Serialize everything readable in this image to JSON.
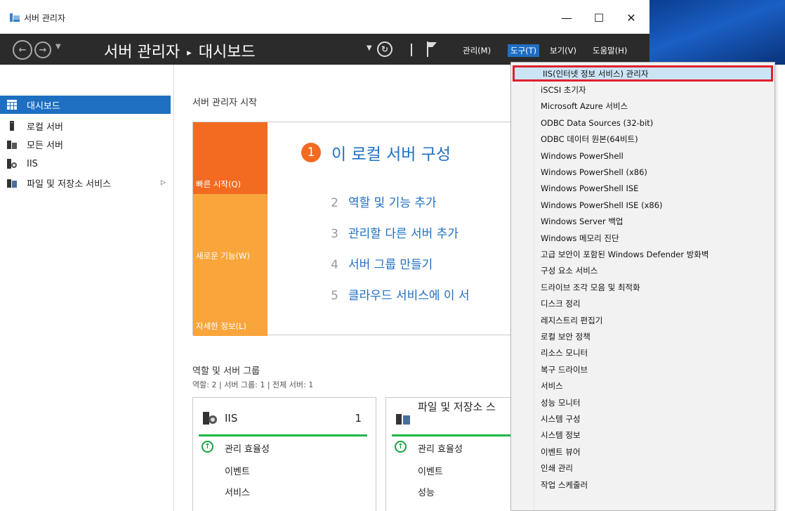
{
  "window": {
    "title": "서버 관리자",
    "minimize": "—",
    "maximize": "☐",
    "close": "✕"
  },
  "header": {
    "breadcrumb_root": "서버 관리자",
    "breadcrumb_sep": "▸",
    "breadcrumb_current": "대시보드",
    "menus": {
      "manage": "관리(M)",
      "tools": "도구(T)",
      "view": "보기(V)",
      "help": "도움말(H)"
    }
  },
  "sidebar": {
    "items": [
      {
        "label": "대시보드",
        "icon": "dashboard-icon"
      },
      {
        "label": "로컬 서버",
        "icon": "server-icon"
      },
      {
        "label": "모든 서버",
        "icon": "servers-icon"
      },
      {
        "label": "IIS",
        "icon": "iis-icon"
      },
      {
        "label": "파일 및 저장소 서비스",
        "icon": "file-storage-icon"
      }
    ]
  },
  "welcome": {
    "title": "서버 관리자 시작",
    "tiles": [
      "빠른 시작(Q)",
      "새로운 기능(W)",
      "자세한 정보(L)"
    ],
    "steps": [
      {
        "num": "1",
        "label": "이 로컬 서버 구성"
      },
      {
        "num": "2",
        "label": "역할 및 기능 추가"
      },
      {
        "num": "3",
        "label": "관리할 다른 서버 추가"
      },
      {
        "num": "4",
        "label": "서버 그룹 만들기"
      },
      {
        "num": "5",
        "label": "클라우드 서비스에 이 서"
      }
    ]
  },
  "roles": {
    "title": "역할 및 서버 그룹",
    "summary": "역할: 2  |  서버 그룹: 1  |  전체 서버: 1",
    "cards": [
      {
        "name": "IIS",
        "count": "1",
        "rows": [
          "관리 효율성",
          "이벤트",
          "서비스"
        ]
      },
      {
        "name": "파일 및 저장소 스",
        "count": "",
        "rows": [
          "관리 효율성",
          "이벤트",
          "성능"
        ]
      }
    ]
  },
  "tools_menu": {
    "items": [
      "IIS(인터넷 정보 서비스) 관리자",
      "iSCSI 초기자",
      "Microsoft Azure 서비스",
      "ODBC Data Sources (32-bit)",
      "ODBC 데이터 원본(64비트)",
      "Windows PowerShell",
      "Windows PowerShell (x86)",
      "Windows PowerShell ISE",
      "Windows PowerShell ISE (x86)",
      "Windows Server 백업",
      "Windows 메모리 진단",
      "고급 보안이 포함된 Windows Defender 방화벽",
      "구성 요소 서비스",
      "드라이브 조각 모음 및 최적화",
      "디스크 정리",
      "레지스트리 편집기",
      "로컬 보안 정책",
      "리소스 모니터",
      "복구 드라이브",
      "서비스",
      "성능 모니터",
      "시스템 구성",
      "시스템 정보",
      "이벤트 뷰어",
      "인쇄 관리",
      "작업 스케줄러"
    ]
  },
  "colors": {
    "accent": "#1e6fc2",
    "header_bg": "#2b2b2b",
    "quick_start": "#f26b21",
    "tile_orange": "#f9a53c",
    "status_green": "#1fb84a",
    "highlight_border": "#e0202c"
  }
}
